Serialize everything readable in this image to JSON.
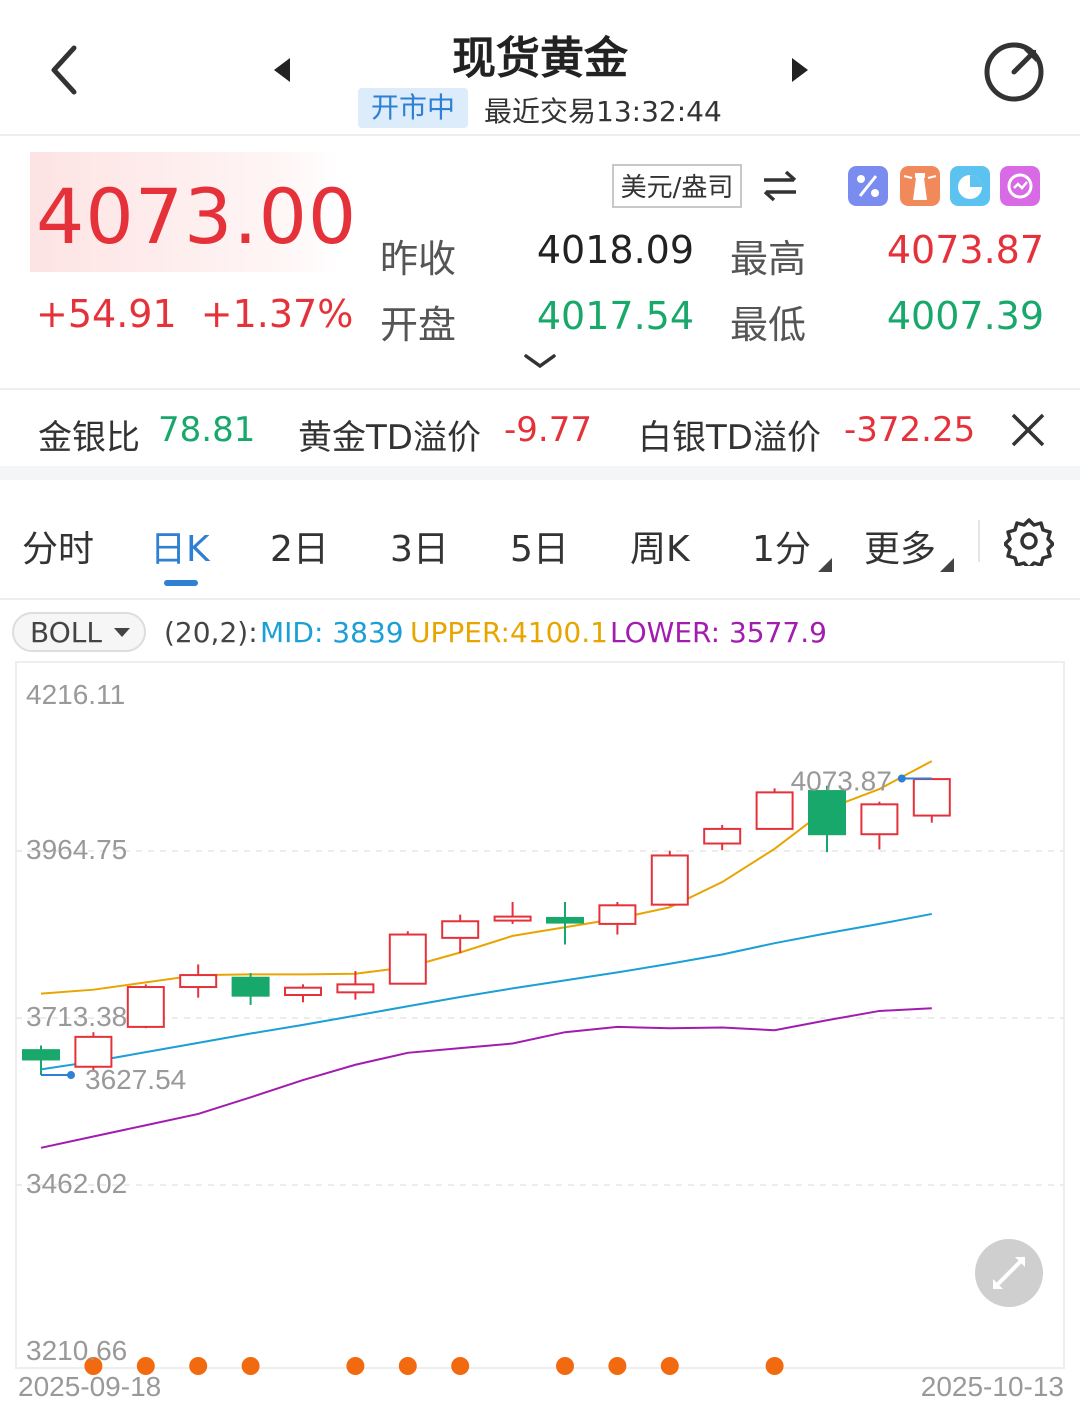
{
  "header": {
    "title": "现货黄金",
    "status": "开市中",
    "last_trade": "最近交易13:32:44"
  },
  "quote": {
    "price": "4073.00",
    "change": "+54.91  +1.37%",
    "currency_button": "美元/盎司",
    "prev_close_label": "昨收",
    "prev_close": "4018.09",
    "open_label": "开盘",
    "open": "4017.54",
    "high_label": "最高",
    "high": "4073.87",
    "low_label": "最低",
    "low": "4007.39",
    "tool_icons": [
      "percent-icon",
      "lighthouse-icon",
      "pie-icon",
      "target-icon"
    ]
  },
  "ratios": {
    "gold_silver_label": "金银比",
    "gold_silver": "78.81",
    "gold_td_label": "黄金TD溢价",
    "gold_td": "-9.77",
    "silver_td_label": "白银TD溢价",
    "silver_td": "-372.25"
  },
  "tabs": [
    "分时",
    "日K",
    "2日",
    "3日",
    "5日",
    "周K",
    "1分",
    "更多"
  ],
  "active_tab": "日K",
  "indicator": {
    "selector": "BOLL",
    "params": "(20,2):",
    "mid": "MID: 3839",
    "upper": "UPPER:4100.1",
    "lower": "LOWER: 3577.9"
  },
  "colors": {
    "up": "#e5323a",
    "down": "#18a86b",
    "accent": "#2f7fd3",
    "upper_band": "#e8a500",
    "mid_band": "#1a9fd6",
    "lower_band": "#a21caf",
    "event_dot": "#f26a10"
  },
  "chart_data": {
    "type": "candlestick",
    "y_axis_labels": [
      "4216.11",
      "3964.75",
      "3713.38",
      "3462.02",
      "3210.66"
    ],
    "ylim": [
      3210.66,
      4216.11
    ],
    "x_start": "2025-09-18",
    "x_end": "2025-10-13",
    "high_marker": "4073.87",
    "low_marker": "3627.54",
    "candles": [
      {
        "open": 3665,
        "close": 3651,
        "high": 3672,
        "low": 3627.54
      },
      {
        "open": 3640,
        "close": 3685,
        "high": 3692,
        "low": 3634
      },
      {
        "open": 3700,
        "close": 3760,
        "high": 3764,
        "low": 3698
      },
      {
        "open": 3760,
        "close": 3778,
        "high": 3794,
        "low": 3744
      },
      {
        "open": 3774,
        "close": 3747,
        "high": 3781,
        "low": 3733
      },
      {
        "open": 3748,
        "close": 3759,
        "high": 3764,
        "low": 3737
      },
      {
        "open": 3752,
        "close": 3764,
        "high": 3784,
        "low": 3741
      },
      {
        "open": 3765,
        "close": 3839,
        "high": 3844,
        "low": 3764
      },
      {
        "open": 3834,
        "close": 3859,
        "high": 3869,
        "low": 3811
      },
      {
        "open": 3860,
        "close": 3866,
        "high": 3888,
        "low": 3855
      },
      {
        "open": 3864,
        "close": 3857,
        "high": 3888,
        "low": 3824
      },
      {
        "open": 3855,
        "close": 3883,
        "high": 3888,
        "low": 3839
      },
      {
        "open": 3884,
        "close": 3958,
        "high": 3965,
        "low": 3882
      },
      {
        "open": 3976,
        "close": 3998,
        "high": 4004,
        "low": 3966
      },
      {
        "open": 3998,
        "close": 4053,
        "high": 4059,
        "low": 3997
      },
      {
        "open": 4055,
        "close": 3990,
        "high": 4063,
        "low": 3963
      },
      {
        "open": 3990,
        "close": 4035,
        "high": 4039,
        "low": 3967
      },
      {
        "open": 4018.09,
        "close": 4073.0,
        "high": 4073.87,
        "low": 4007.39
      }
    ],
    "boll_upper": [
      3750,
      3756,
      3767,
      3778,
      3779,
      3779,
      3780,
      3790,
      3812,
      3837,
      3850,
      3863,
      3880,
      3918,
      3968,
      4028,
      4058,
      4100.1
    ],
    "boll_mid": [
      3636,
      3648,
      3662,
      3676,
      3690,
      3703,
      3717,
      3731,
      3745,
      3758,
      3770,
      3782,
      3795,
      3809,
      3826,
      3841,
      3855,
      3870
    ],
    "boll_lower": [
      3518,
      3535,
      3552,
      3569,
      3594,
      3620,
      3643,
      3661,
      3668,
      3675,
      3692,
      3700,
      3698,
      3699,
      3695,
      3710,
      3724,
      3728
    ],
    "event_markers": [
      1,
      2,
      3,
      4,
      6,
      7,
      8,
      10,
      11,
      12,
      14
    ]
  }
}
